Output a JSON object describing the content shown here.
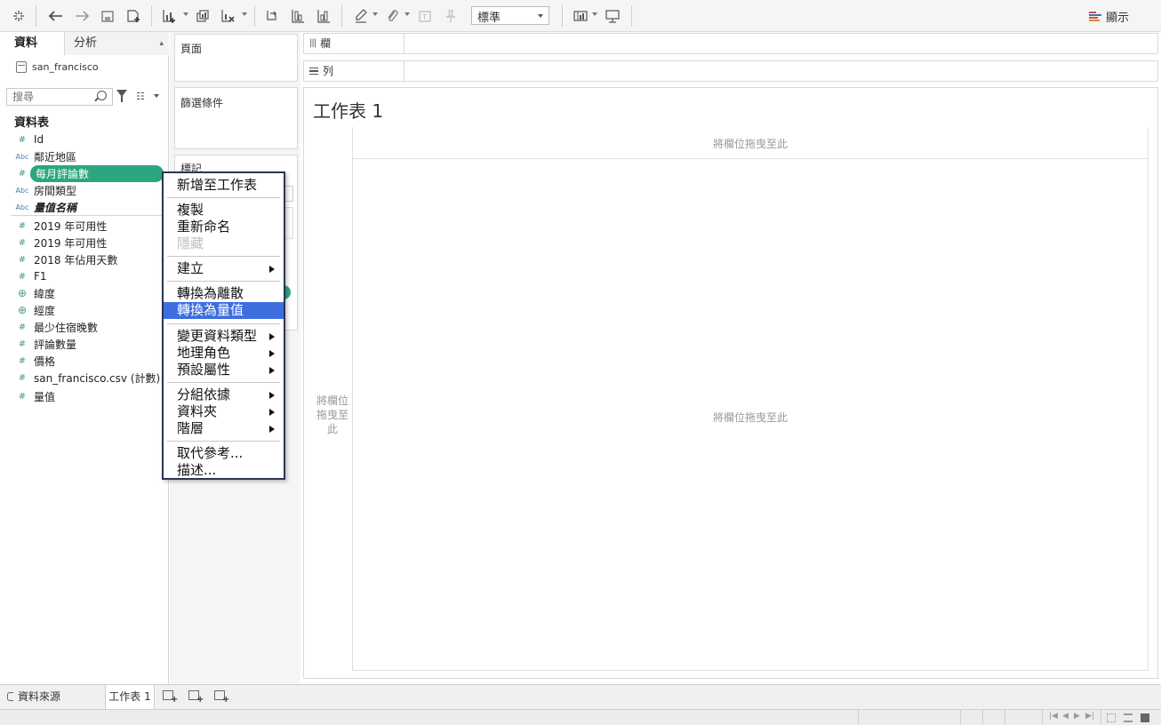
{
  "toolbar": {
    "fit_value": "標準",
    "show_me_label": "顯示",
    "show_me_colors": [
      "#d94b4b",
      "#4a6fb0",
      "#e0893a"
    ]
  },
  "left_pane": {
    "tab_data": "資料",
    "tab_analysis": "分析",
    "datasource_name": "san_francisco",
    "search_placeholder": "搜尋",
    "tables_heading": "資料表",
    "dimensions": [
      {
        "type": "number",
        "label": "Id"
      },
      {
        "type": "abc",
        "label": "鄰近地區"
      },
      {
        "type": "number",
        "label": "每月評論數"
      },
      {
        "type": "abc",
        "label": "房間類型"
      },
      {
        "type": "abc",
        "label": "量值名稱"
      }
    ],
    "measures": [
      {
        "type": "number",
        "label": "2019 年可用性"
      },
      {
        "type": "number",
        "label": "2019 年可用性"
      },
      {
        "type": "number",
        "label": "2018 年佔用天數"
      },
      {
        "type": "number",
        "label": "F1"
      },
      {
        "type": "globe",
        "label": "緯度"
      },
      {
        "type": "globe",
        "label": "經度"
      },
      {
        "type": "number",
        "label": "最少住宿晚數"
      },
      {
        "type": "number",
        "label": "評論數量"
      },
      {
        "type": "number",
        "label": "價格"
      },
      {
        "type": "number",
        "label": "san_francisco.csv (計數)"
      },
      {
        "type": "number",
        "label": "量值"
      }
    ]
  },
  "shelves": {
    "pages_label": "頁面",
    "filters_label": "篩選條件",
    "marks_label": "標記",
    "columns_label": "欄",
    "rows_label": "列"
  },
  "worksheet": {
    "title": "工作表 1",
    "drop_columns_hint": "將欄位拖曳至此",
    "drop_rows_hint_lines": [
      "將欄位",
      "拖曳至",
      "此"
    ],
    "drop_body_hint": "將欄位拖曳至此"
  },
  "context_menu": {
    "items": [
      "新增至工作表",
      "複製",
      "重新命名",
      "隱藏",
      "建立",
      "轉換為離散",
      "轉換為量值",
      "變更資料類型",
      "地理角色",
      "預設屬性",
      "分組依據",
      "資料夾",
      "階層",
      "取代參考...",
      "描述..."
    ]
  },
  "bottom_tabs": {
    "datasource_tab": "資料來源",
    "sheet_tab": "工作表 1"
  },
  "colors": {
    "accent_green": "#2ca680",
    "menu_highlight": "#3d6ee0",
    "menu_border": "#2b3550"
  }
}
